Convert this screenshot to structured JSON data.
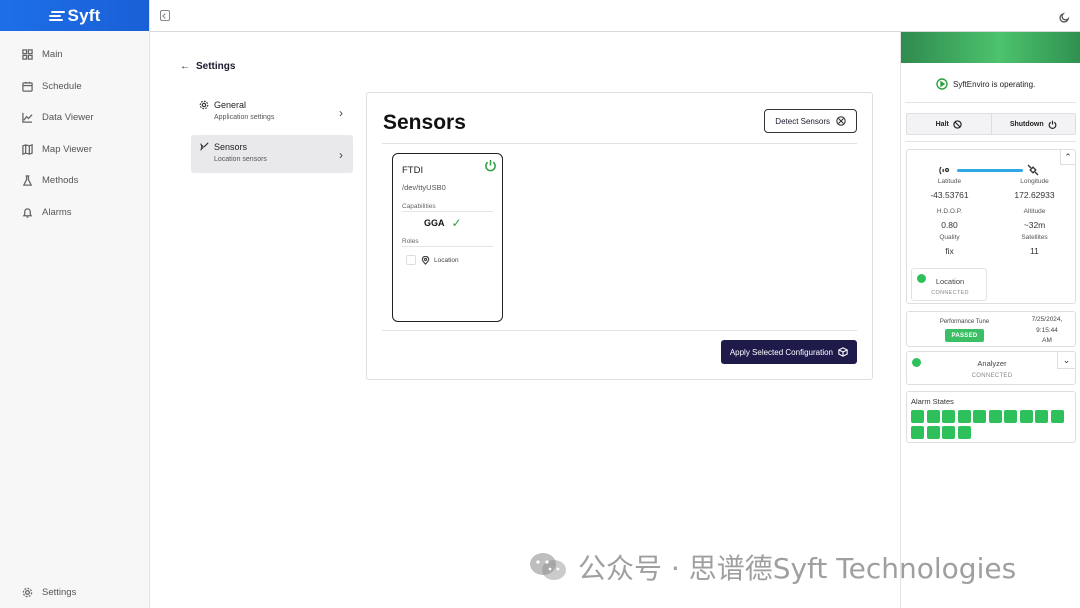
{
  "app": {
    "logo": "Syft"
  },
  "sidebar": {
    "items": [
      {
        "label": "Main",
        "icon": "grid-icon"
      },
      {
        "label": "Schedule",
        "icon": "calendar-icon"
      },
      {
        "label": "Data Viewer",
        "icon": "chart-icon"
      },
      {
        "label": "Map Viewer",
        "icon": "map-icon"
      },
      {
        "label": "Methods",
        "icon": "flask-icon"
      },
      {
        "label": "Alarms",
        "icon": "bell-icon"
      }
    ],
    "settings_label": "Settings"
  },
  "page": {
    "back_label": "Settings"
  },
  "settings_nav": [
    {
      "title": "General",
      "subtitle": "Application settings",
      "active": false
    },
    {
      "title": "Sensors",
      "subtitle": "Location sensors",
      "active": true
    }
  ],
  "sensors_panel": {
    "title": "Sensors",
    "detect_label": "Detect Sensors",
    "apply_label": "Apply Selected Configuration",
    "card": {
      "name": "FTDI",
      "path": "/dev/ttyUSB0",
      "capabilities_label": "Capabilities",
      "capability": "GGA",
      "roles_label": "Roles",
      "role": "Location"
    }
  },
  "right_panel": {
    "status": "SyftEnviro is operating.",
    "halt_label": "Halt",
    "shutdown_label": "Shutdown",
    "gps": {
      "fields": [
        {
          "label": "Latitude",
          "value": "-43.53761"
        },
        {
          "label": "Longitude",
          "value": "172.62933"
        },
        {
          "label": "H.D.O.P.",
          "value": "0.80"
        },
        {
          "label": "Altitude",
          "value": "~32m"
        },
        {
          "label": "Quality",
          "value": "fix"
        },
        {
          "label": "Satellites",
          "value": "11"
        }
      ],
      "chip_name": "Location",
      "chip_status": "CONNECTED"
    },
    "performance": {
      "name": "Performance Tune",
      "badge": "PASSED",
      "time_line1": "7/25/2024,",
      "time_line2": "9:15:44",
      "time_line3": "AM"
    },
    "analyzer": {
      "name": "Analyzer",
      "status": "CONNECTED"
    },
    "alarms": {
      "title": "Alarm States",
      "count": 14,
      "color": "#2ec05a"
    }
  },
  "watermark": {
    "text": "公众号 · 思谱德Syft Technologies"
  },
  "colors": {
    "brand": "#1d6fe8",
    "primary_button": "#1e1b4b",
    "ok": "#2ec05a"
  }
}
